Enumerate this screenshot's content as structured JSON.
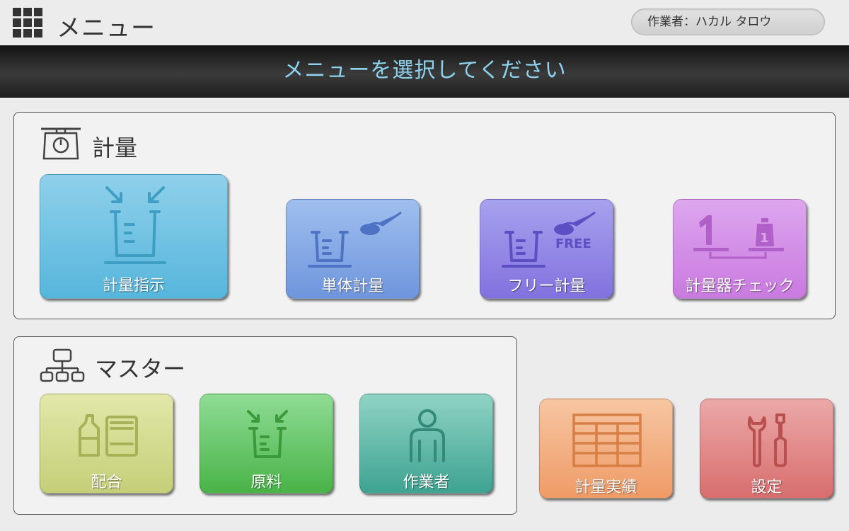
{
  "header": {
    "title": "メニュー",
    "operator": "作業者：ハカル タロウ"
  },
  "banner": {
    "text": "メニューを選択してください",
    "color": "#8ed3ee"
  },
  "weighing_section": {
    "title": "計量",
    "tiles": [
      {
        "label": "計量指示",
        "icon": "beaker-arrows-icon",
        "color": "#56b6dc"
      },
      {
        "label": "単体計量",
        "icon": "beaker-scoop-icon",
        "color": "#6f95dd"
      },
      {
        "label": "フリー計量",
        "icon": "beaker-scoop-free-icon",
        "badge": "FREE",
        "color": "#8271de"
      },
      {
        "label": "計量器チェック",
        "icon": "scale-weight-check-icon",
        "color": "#c97adf"
      }
    ]
  },
  "master_section": {
    "title": "マスター",
    "tiles": [
      {
        "label": "配合",
        "icon": "bottle-box-icon",
        "color": "#c4cf78"
      },
      {
        "label": "原料",
        "icon": "beaker-arrows-icon",
        "color": "#49b347"
      },
      {
        "label": "作業者",
        "icon": "person-icon",
        "color": "#3ea391"
      }
    ]
  },
  "extra_tiles": [
    {
      "label": "計量実績",
      "icon": "table-grid-icon",
      "color": "#ef9b66"
    },
    {
      "label": "設定",
      "icon": "tools-icon",
      "color": "#d86e6e"
    }
  ]
}
